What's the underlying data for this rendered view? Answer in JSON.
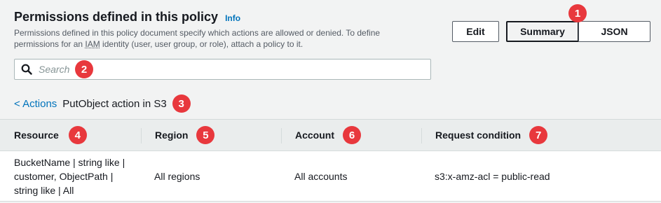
{
  "header": {
    "title": "Permissions defined in this policy",
    "info_label": "Info",
    "description_before": "Permissions defined in this policy document specify which actions are allowed or denied. To define permissions for an ",
    "description_iam": "IAM",
    "description_after": " identity (user, user group, or role), attach a policy to it."
  },
  "buttons": {
    "edit": "Edit",
    "summary": "Summary",
    "json": "JSON",
    "selected_view": "Summary"
  },
  "search": {
    "placeholder": "Search"
  },
  "breadcrumb": {
    "back_link": "< Actions",
    "current": "PutObject action in S3"
  },
  "table": {
    "columns": [
      "Resource",
      "Region",
      "Account",
      "Request condition"
    ],
    "rows": [
      {
        "resource_line1": "BucketName | string like |",
        "resource_line2": "customer, ObjectPath |",
        "resource_line3": "string like | All",
        "region": "All regions",
        "account": "All accounts",
        "request_condition": "s3:x-amz-acl = public-read"
      }
    ]
  },
  "markers": [
    "1",
    "2",
    "3",
    "4",
    "5",
    "6",
    "7"
  ],
  "colors": {
    "marker": "#e8383d",
    "link": "#0073bb",
    "background": "#f2f3f3"
  }
}
